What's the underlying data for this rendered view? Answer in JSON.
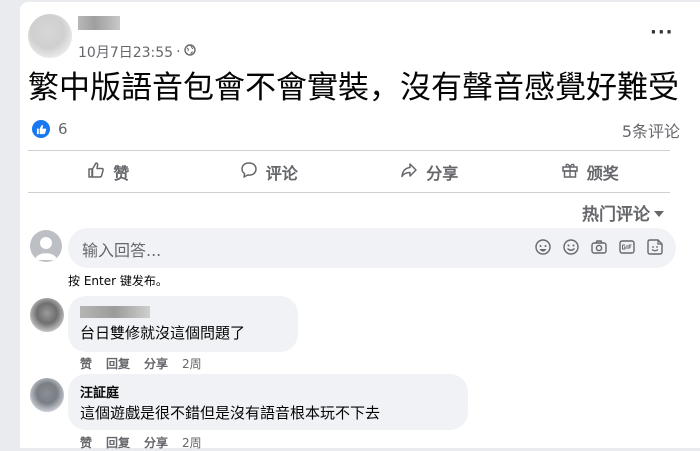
{
  "post": {
    "timestamp": "10月7日23:55",
    "privacy_separator": "·",
    "text": "繁中版語音包會不會實裝，沒有聲音感覺好難受",
    "more_label": "···"
  },
  "reactions": {
    "like_count": "6",
    "comments_count_label": "5条评论"
  },
  "actions": [
    {
      "label": "赞",
      "icon": "thumbs-up-icon"
    },
    {
      "label": "评论",
      "icon": "comment-icon"
    },
    {
      "label": "分享",
      "icon": "share-icon"
    },
    {
      "label": "颁奖",
      "icon": "gift-icon"
    }
  ],
  "sort": {
    "label": "热门评论"
  },
  "composer": {
    "placeholder": "输入回答...",
    "hint": "按 Enter 键发布。",
    "icons": [
      "sticker-icon",
      "emoji-icon",
      "camera-icon",
      "gif-icon",
      "avatar-sticker-icon"
    ]
  },
  "comments": [
    {
      "author": "",
      "text": "台日雙修就沒這個問題了",
      "like_label": "赞",
      "reply_label": "回复",
      "share_label": "分享",
      "time": "2周"
    },
    {
      "author": "汪証庭",
      "text": "這個遊戲是很不錯但是沒有語音根本玩不下去",
      "like_label": "赞",
      "reply_label": "回复",
      "share_label": "分享",
      "time": "2周"
    }
  ],
  "colors": {
    "accent": "#1877f2",
    "muted_text": "#65676b",
    "bubble_bg": "#f0f2f5"
  }
}
